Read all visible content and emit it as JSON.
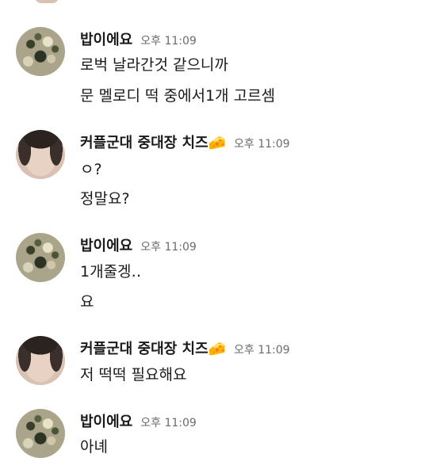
{
  "messages": [
    {
      "sender": "밥이에요",
      "time": "오후 11:09",
      "avatar": "food-photo-avatar",
      "lines": [
        "로벅 날라간것 같으니까",
        "문 멜로디 떡 중에서1개 고르셈"
      ]
    },
    {
      "sender": "커플군대 중대장 치즈",
      "sender_emoji": "🧀",
      "time": "오후 11:09",
      "avatar": "person-photo-avatar",
      "lines": [
        "ㅇ?",
        "정말요?"
      ]
    },
    {
      "sender": "밥이에요",
      "time": "오후 11:09",
      "avatar": "food-photo-avatar",
      "lines": [
        "1개줄겡‥",
        "요"
      ]
    },
    {
      "sender": "커플군대 중대장 치즈",
      "sender_emoji": "🧀",
      "time": "오후 11:09",
      "avatar": "person-photo-avatar",
      "lines": [
        "저 떡떡 필요해요"
      ]
    },
    {
      "sender": "밥이에요",
      "time": "오후 11:09",
      "avatar": "food-photo-avatar",
      "lines": [
        "아녜"
      ]
    }
  ]
}
